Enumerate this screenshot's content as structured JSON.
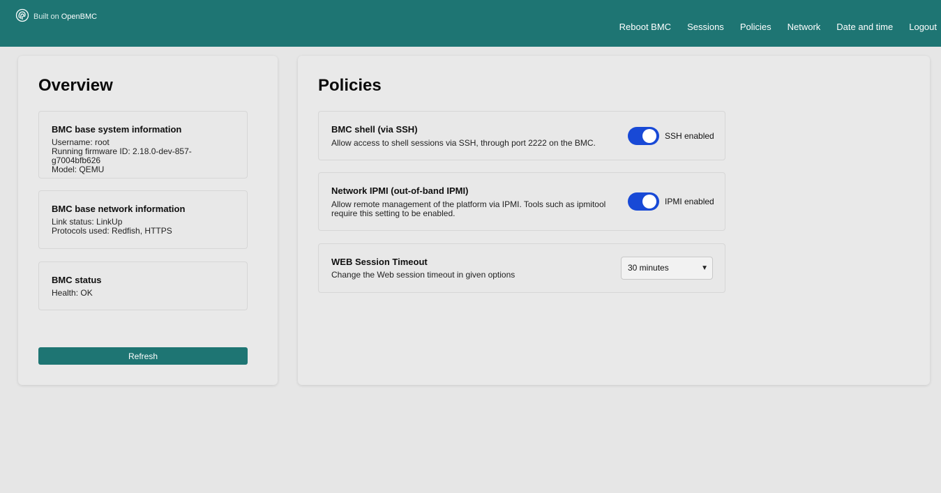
{
  "brand": {
    "prefix": "Built on",
    "name": "OpenBMC",
    "logo_icon": "openbmc-logo-icon"
  },
  "nav": {
    "items": [
      "Reboot BMC",
      "Sessions",
      "Policies",
      "Network",
      "Date and time",
      "Logout"
    ]
  },
  "colors": {
    "header": "#1e7573",
    "toggle_on": "#1849d6",
    "button": "#1e7573",
    "background": "#e6e6e6"
  },
  "overview": {
    "title": "Overview",
    "system": {
      "heading": "BMC base system information",
      "username": "Username: root",
      "firmware": "Running firmware ID: 2.18.0-dev-857-g7004bfb626",
      "model": "Model: QEMU"
    },
    "network": {
      "heading": "BMC base network information",
      "link": "Link status: LinkUp",
      "protocols": "Protocols used: Redfish, HTTPS"
    },
    "status": {
      "heading": "BMC status",
      "health": "Health: OK"
    },
    "refresh_label": "Refresh"
  },
  "policies": {
    "title": "Policies",
    "ssh": {
      "heading": "BMC shell (via SSH)",
      "description": "Allow access to shell sessions via SSH, through port 2222 on the BMC.",
      "state_label": "SSH enabled",
      "enabled": true
    },
    "ipmi": {
      "heading": "Network IPMI (out-of-band IPMI)",
      "description": "Allow remote management of the platform via IPMI. Tools such as ipmitool require this setting to be enabled.",
      "state_label": "IPMI enabled",
      "enabled": true
    },
    "timeout": {
      "heading": "WEB Session Timeout",
      "description": "Change the Web session timeout in given options",
      "selected": "30 minutes"
    }
  }
}
